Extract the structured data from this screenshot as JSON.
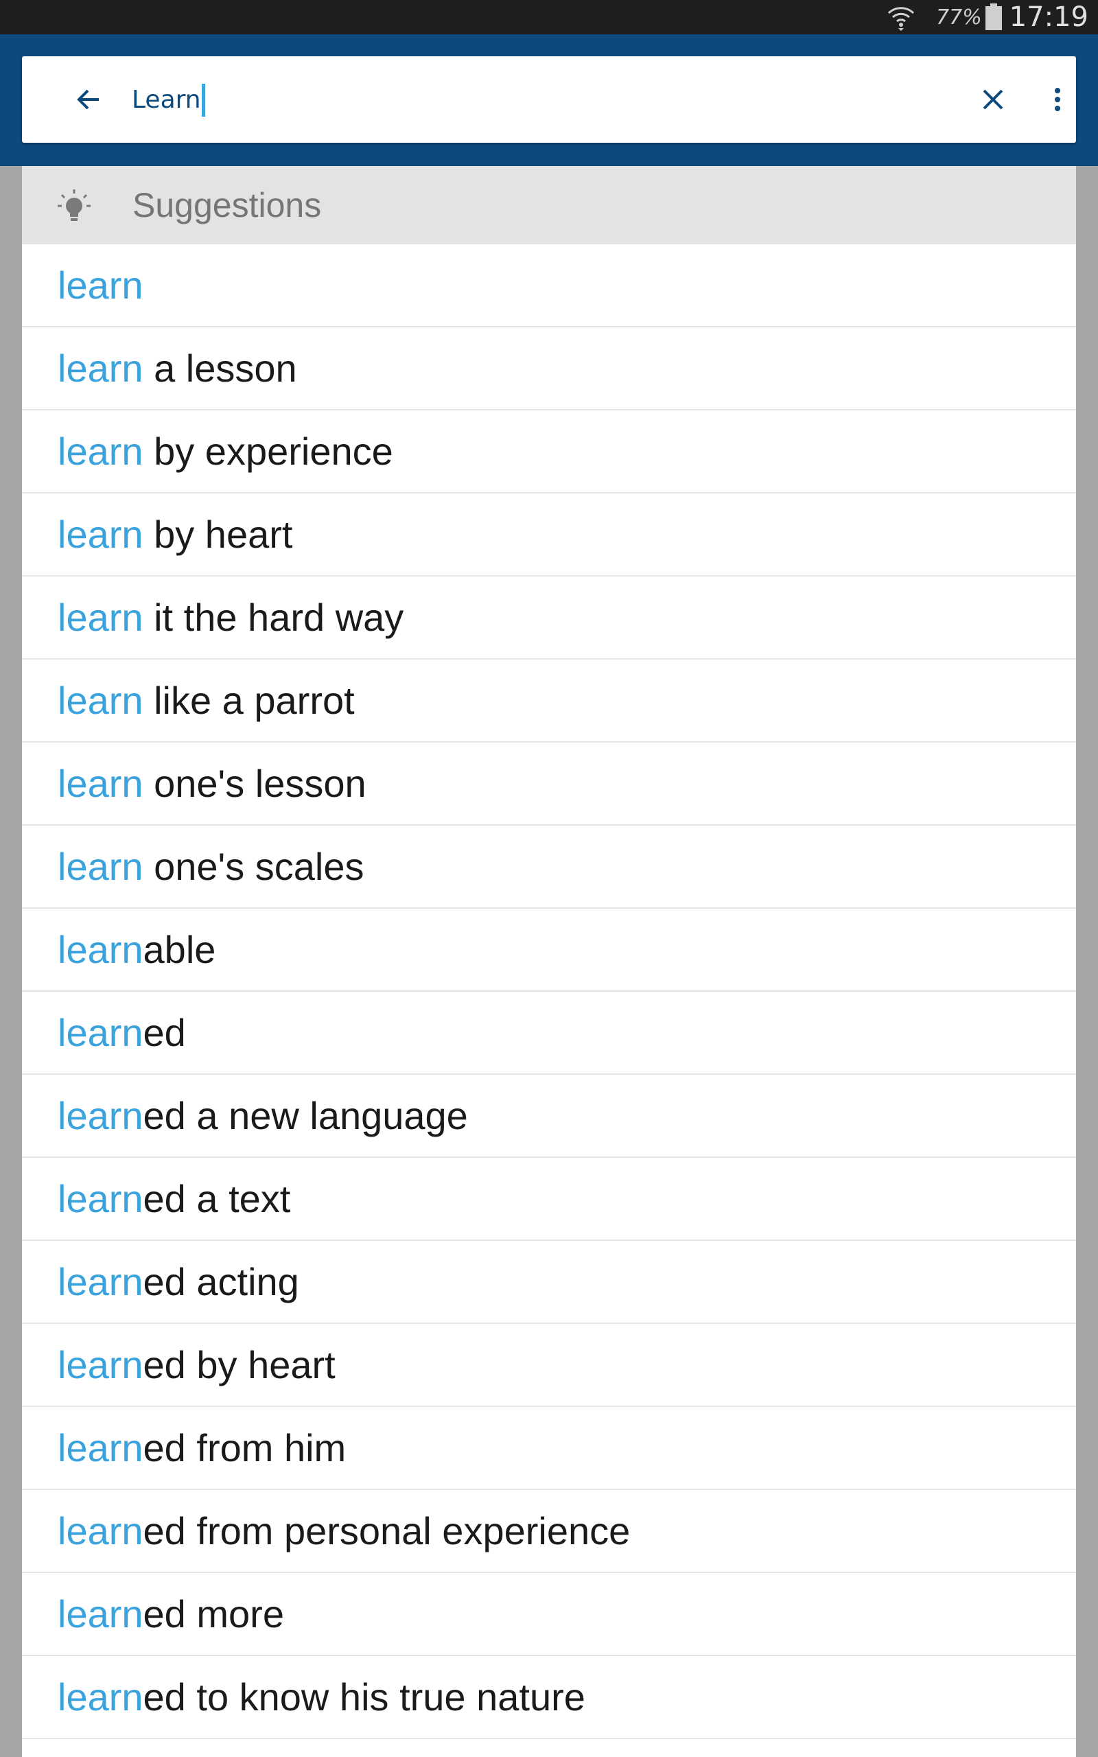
{
  "status_bar": {
    "battery_percent": "77%",
    "time": "17:19",
    "icons": [
      "wifi-icon",
      "battery-icon"
    ]
  },
  "search": {
    "query": "Learn",
    "icons": [
      "arrow-back-icon",
      "close-icon",
      "more-vert-icon"
    ]
  },
  "suggestions": {
    "header": "Suggestions",
    "header_icon": "lightbulb-icon",
    "highlight_color": "#3aa2dc",
    "items": [
      {
        "match": "learn",
        "rest": ""
      },
      {
        "match": "learn",
        "rest": " a lesson"
      },
      {
        "match": "learn",
        "rest": " by experience"
      },
      {
        "match": "learn",
        "rest": " by heart"
      },
      {
        "match": "learn",
        "rest": " it the hard way"
      },
      {
        "match": "learn",
        "rest": " like a parrot"
      },
      {
        "match": "learn",
        "rest": " one's lesson"
      },
      {
        "match": "learn",
        "rest": " one's scales"
      },
      {
        "match": "learn",
        "rest": "able"
      },
      {
        "match": "learn",
        "rest": "ed"
      },
      {
        "match": "learn",
        "rest": "ed a new language"
      },
      {
        "match": "learn",
        "rest": "ed a text"
      },
      {
        "match": "learn",
        "rest": "ed acting"
      },
      {
        "match": "learn",
        "rest": "ed by heart"
      },
      {
        "match": "learn",
        "rest": "ed from him"
      },
      {
        "match": "learn",
        "rest": "ed from personal experience"
      },
      {
        "match": "learn",
        "rest": "ed more"
      },
      {
        "match": "learn",
        "rest": "ed to know his true nature"
      }
    ]
  }
}
